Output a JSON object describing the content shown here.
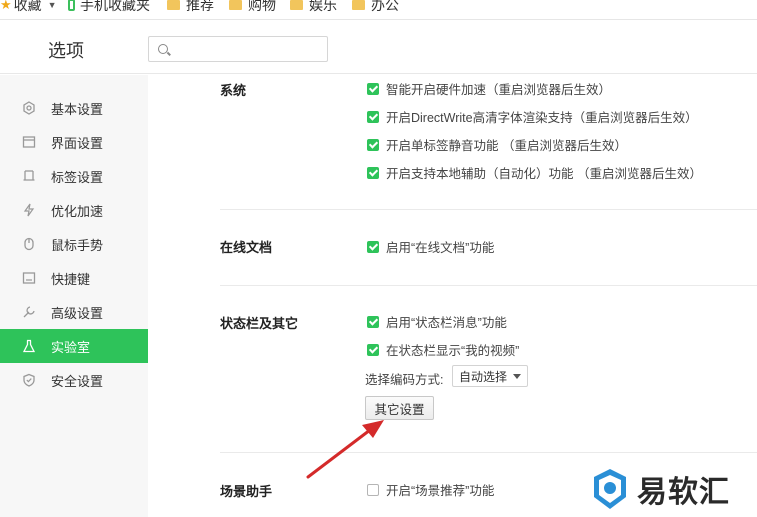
{
  "bookmarks": [
    {
      "label": "收藏",
      "icon": "star-icon"
    },
    {
      "label": "手机收藏夹",
      "icon": "phone-icon"
    },
    {
      "label": "推荐",
      "icon": "folder-icon"
    },
    {
      "label": "购物",
      "icon": "folder-icon"
    },
    {
      "label": "娱乐",
      "icon": "folder-icon"
    },
    {
      "label": "办公",
      "icon": "folder-icon"
    }
  ],
  "header": {
    "title": "选项",
    "search_placeholder": ""
  },
  "sidebar": {
    "items": [
      {
        "label": "基本设置",
        "icon": "gear-icon"
      },
      {
        "label": "界面设置",
        "icon": "window-icon"
      },
      {
        "label": "标签设置",
        "icon": "tab-icon"
      },
      {
        "label": "优化加速",
        "icon": "lightning-icon"
      },
      {
        "label": "鼠标手势",
        "icon": "mouse-icon"
      },
      {
        "label": "快捷键",
        "icon": "keyboard-icon"
      },
      {
        "label": "高级设置",
        "icon": "wrench-icon"
      },
      {
        "label": "实验室",
        "icon": "flask-icon",
        "active": true
      },
      {
        "label": "安全设置",
        "icon": "shield-icon"
      }
    ]
  },
  "sections": {
    "system": {
      "title": "系统",
      "options": [
        {
          "label": "智能开启硬件加速（重启浏览器后生效）",
          "checked": true
        },
        {
          "label": "开启DirectWrite高清字体渲染支持（重启浏览器后生效）",
          "checked": true
        },
        {
          "label": "开启单标签静音功能 （重启浏览器后生效）",
          "checked": true
        },
        {
          "label": "开启支持本地辅助（自动化）功能 （重启浏览器后生效）",
          "checked": true
        }
      ]
    },
    "online_docs": {
      "title": "在线文档",
      "options": [
        {
          "label": "启用“在线文档”功能",
          "checked": true
        }
      ]
    },
    "statusbar": {
      "title": "状态栏及其它",
      "options": [
        {
          "label": "启用“状态栏消息”功能",
          "checked": true
        },
        {
          "label": "在状态栏显示“我的视频”",
          "checked": true
        }
      ],
      "encoding_label": "选择编码方式:",
      "encoding_value": "自动选择",
      "other_button": "其它设置"
    },
    "scene": {
      "title": "场景助手",
      "options": [
        {
          "label": "开启“场景推荐”功能",
          "checked": false
        }
      ]
    }
  },
  "colors": {
    "accent": "#2ec35a",
    "arrow": "#d42a2a"
  },
  "watermark": {
    "text": "易软汇"
  }
}
